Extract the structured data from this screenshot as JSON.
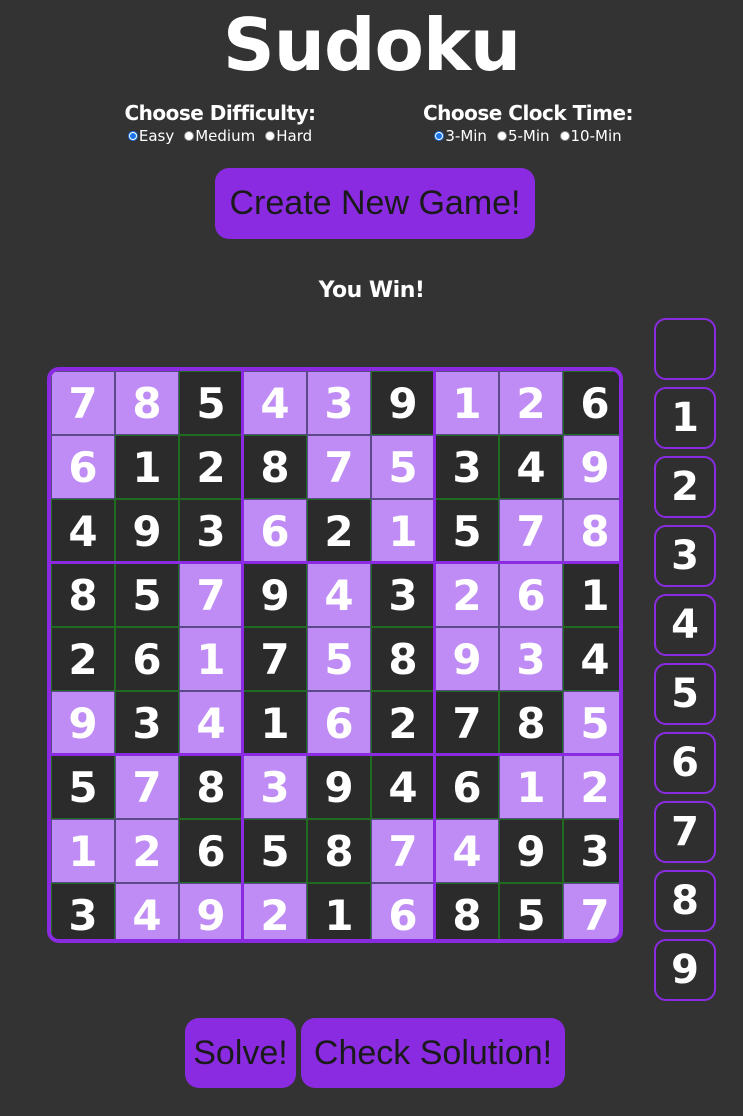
{
  "title": "Sudoku",
  "difficulty": {
    "label": "Choose Difficulty:",
    "options": [
      "Easy",
      "Medium",
      "Hard"
    ],
    "selected": "Easy"
  },
  "clock": {
    "label": "Choose Clock Time:",
    "options": [
      "3-Min",
      "5-Min",
      "10-Min"
    ],
    "selected": "3-Min"
  },
  "buttons": {
    "create": "Create New Game!",
    "solve": "Solve!",
    "check": "Check Solution!"
  },
  "status": "You Win!",
  "colors": {
    "accent": "#8a2be2",
    "light_cell": "#bf8cf5",
    "dark_cell": "#2b2b2b",
    "background": "#333333",
    "grid_line": "#1f6b1f"
  },
  "board": {
    "values": [
      [
        7,
        8,
        5,
        4,
        3,
        9,
        1,
        2,
        6
      ],
      [
        6,
        1,
        2,
        8,
        7,
        5,
        3,
        4,
        9
      ],
      [
        4,
        9,
        3,
        6,
        2,
        1,
        5,
        7,
        8
      ],
      [
        8,
        5,
        7,
        9,
        4,
        3,
        2,
        6,
        1
      ],
      [
        2,
        6,
        1,
        7,
        5,
        8,
        9,
        3,
        4
      ],
      [
        9,
        3,
        4,
        1,
        6,
        2,
        7,
        8,
        5
      ],
      [
        5,
        7,
        8,
        3,
        9,
        4,
        6,
        1,
        2
      ],
      [
        1,
        2,
        6,
        5,
        8,
        7,
        4,
        9,
        3
      ],
      [
        3,
        4,
        9,
        2,
        1,
        6,
        8,
        5,
        7
      ]
    ],
    "highlighted": [
      [
        1,
        1,
        0,
        1,
        1,
        0,
        1,
        1,
        0
      ],
      [
        1,
        0,
        0,
        0,
        1,
        1,
        0,
        0,
        1
      ],
      [
        0,
        0,
        0,
        1,
        0,
        1,
        0,
        1,
        1
      ],
      [
        0,
        0,
        1,
        0,
        1,
        0,
        1,
        1,
        0
      ],
      [
        0,
        0,
        1,
        0,
        1,
        0,
        1,
        1,
        0
      ],
      [
        1,
        0,
        1,
        0,
        1,
        0,
        0,
        0,
        1
      ],
      [
        0,
        1,
        0,
        1,
        0,
        0,
        0,
        1,
        1
      ],
      [
        1,
        1,
        0,
        0,
        0,
        1,
        1,
        0,
        0
      ],
      [
        0,
        1,
        1,
        1,
        0,
        1,
        0,
        0,
        1
      ]
    ]
  },
  "palette": [
    "",
    "1",
    "2",
    "3",
    "4",
    "5",
    "6",
    "7",
    "8",
    "9"
  ]
}
